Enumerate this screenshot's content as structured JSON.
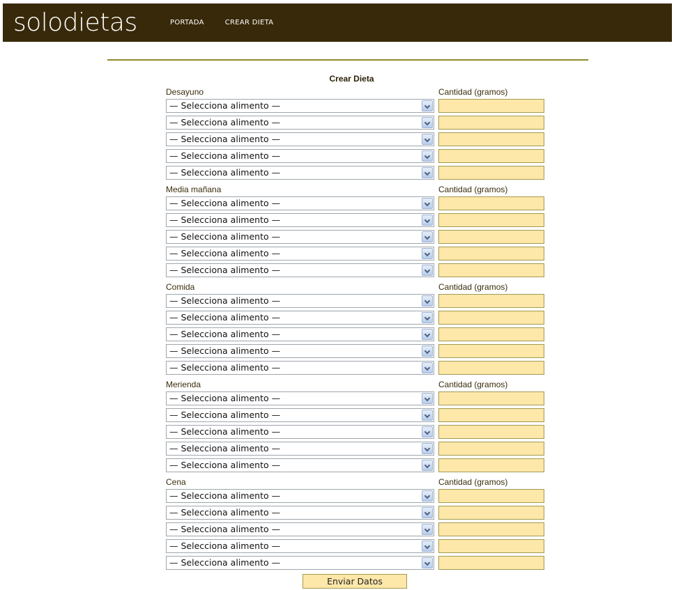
{
  "header": {
    "logo": "solodietas",
    "nav": [
      {
        "label": "PORTADA"
      },
      {
        "label": "CREAR DIETA"
      }
    ]
  },
  "form": {
    "title": "Crear Dieta",
    "quantity_label": "Cantidad (gramos)",
    "select_default": "— Selecciona alimento —",
    "rows_per_section": 5,
    "sections": [
      {
        "label": "Desayuno"
      },
      {
        "label": "Media mañana"
      },
      {
        "label": "Comida"
      },
      {
        "label": "Merienda"
      },
      {
        "label": "Cena"
      }
    ],
    "submit_label": "Enviar Datos"
  },
  "colors": {
    "header_bg": "#38290a",
    "rule": "#8e8a2b",
    "input_bg": "#fde7a9"
  }
}
